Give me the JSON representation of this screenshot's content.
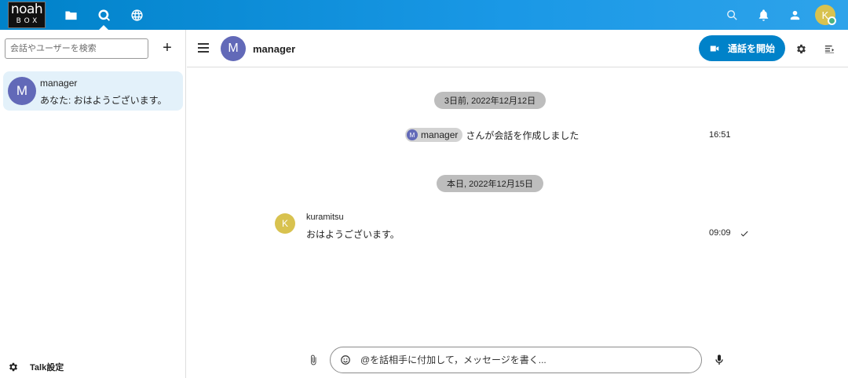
{
  "header": {
    "logo_line1": "noah",
    "logo_line2": "BOX",
    "user_initial": "K"
  },
  "sidebar": {
    "search_placeholder": "会話やユーザーを検索",
    "add_label": "+",
    "conversations": [
      {
        "initial": "M",
        "name": "manager",
        "last_message": "あなた: おはようございます。"
      }
    ],
    "settings_label": "Talk設定"
  },
  "chat": {
    "avatar_initial": "M",
    "title": "manager",
    "call_button_label": "通話を開始",
    "messages": [
      {
        "type": "date",
        "label": "3日前, 2022年12月12日"
      },
      {
        "type": "system",
        "mention_initial": "M",
        "mention_name": "manager",
        "text": "さんが会話を作成しました",
        "time": "16:51"
      },
      {
        "type": "date",
        "label": "本日, 2022年12月15日"
      },
      {
        "type": "message",
        "author_initial": "K",
        "author": "kuramitsu",
        "text": "おはようございます。",
        "time": "09:09"
      }
    ],
    "composer_placeholder": "@を話相手に付加して，メッセージを書く..."
  },
  "colors": {
    "header_bg": "#0082c9",
    "accent": "#0082c9",
    "avatar_manager": "#6269b8",
    "avatar_kuramitsu": "#d8c24f",
    "selected_conversation": "#e3f1fa",
    "status_online": "#49b382"
  }
}
